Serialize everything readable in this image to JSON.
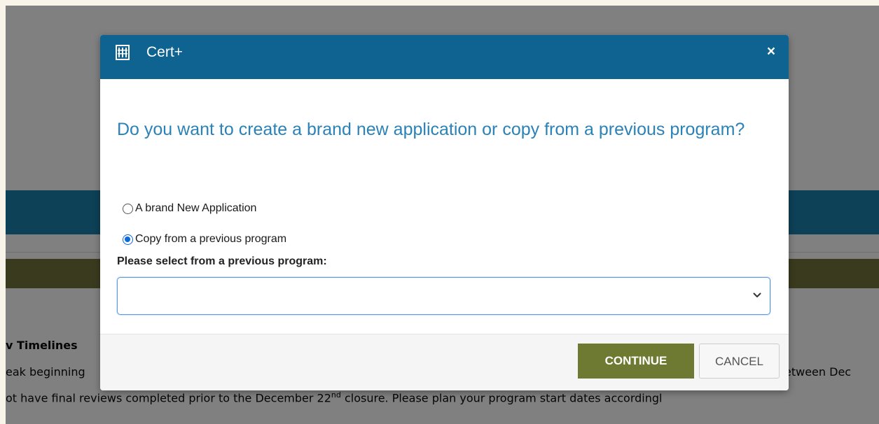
{
  "background_page": {
    "heading": "v Timelines",
    "line1_left": "eak beginning",
    "line1_right": "etween Dec",
    "line2_before_sup": "ot have final reviews completed prior to the December 22",
    "line2_sup": "nd",
    "line2_after_sup": " closure. Please plan your program start dates accordingl"
  },
  "modal": {
    "title": "Cert+",
    "close_symbol": "×",
    "question": "Do you want to create a brand new application or copy from a previous program?",
    "options": [
      {
        "label": "A brand New Application",
        "selected": false
      },
      {
        "label": "Copy from a previous program",
        "selected": true
      }
    ],
    "select_label": "Please select from a previous program:",
    "select_value": "",
    "buttons": {
      "continue": "CONTINUE",
      "cancel": "CANCEL"
    },
    "icons": {
      "logo": "building-logo-icon",
      "close": "close-icon",
      "dropdown": "chevron-down-icon"
    }
  },
  "colors": {
    "header": "#0e6391",
    "question_text": "#2a82b8",
    "continue_button": "#6e7a32",
    "radio_selected": "#0b6ad8",
    "overlay": "#808080"
  }
}
